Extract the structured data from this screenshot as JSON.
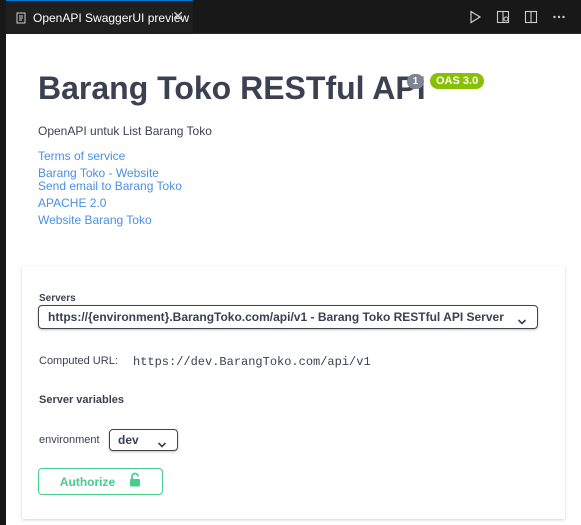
{
  "tab": {
    "title": "OpenAPI SwaggerUI preview",
    "close_glyph": "✕",
    "icon": "preview-document-icon"
  },
  "toolbar": {
    "icons": [
      "run-icon",
      "open-preview-icon",
      "split-editor-icon",
      "more-actions-icon"
    ]
  },
  "info": {
    "title": "Barang Toko RESTful API",
    "version": "1",
    "oas_badge": "OAS 3.0",
    "description": "OpenAPI untuk List Barang Toko",
    "links": {
      "terms": "Terms of service",
      "website": "Barang Toko - Website",
      "email": "Send email to Barang Toko",
      "license": "APACHE 2.0",
      "external_docs": "Website Barang Toko"
    }
  },
  "servers": {
    "label": "Servers",
    "selected": "https://{environment}.BarangToko.com/api/v1 - Barang Toko RESTful API Server",
    "computed_url_label": "Computed URL:",
    "computed_url": "https://dev.BarangToko.com/api/v1",
    "variables_heading": "Server variables",
    "variables": {
      "environment_label": "environment",
      "environment_value": "dev"
    }
  },
  "authorize": {
    "label": "Authorize",
    "icon": "unlocked-padlock-icon"
  },
  "colors": {
    "accent_green": "#49cc90",
    "link_blue": "#4990e2",
    "oas_badge": "#89bf04",
    "version_badge": "#7d8492",
    "text": "#3b4151",
    "vscode_tab_border": "#0078d4"
  }
}
